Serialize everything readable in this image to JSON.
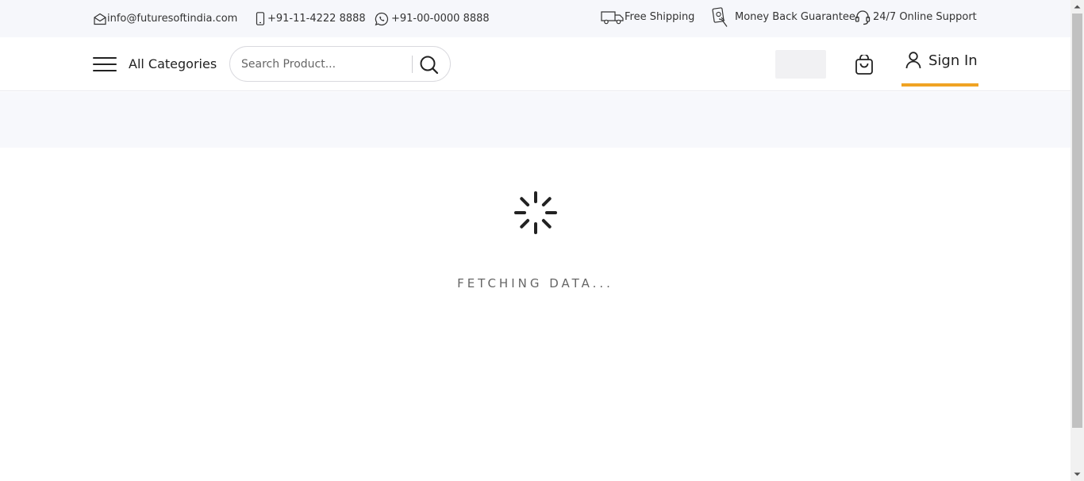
{
  "topbar": {
    "email": "info@futuresoftindia.com",
    "phone": "+91-11-4222 8888",
    "whatsapp": "+91-00-0000 8888",
    "shipping": "Free Shipping",
    "money_back": "Money Back Guarantee",
    "support": "24/7 Online Support"
  },
  "header": {
    "categories_label": "All Categories",
    "search_placeholder": "Search Product...",
    "signin_label": "Sign In",
    "accent_color": "#f0a323"
  },
  "loader": {
    "status_text": "FETCHING DATA..."
  },
  "icons": [
    "mail-icon",
    "phone-icon",
    "whatsapp-icon",
    "truck-icon",
    "money-back-icon",
    "headset-icon",
    "menu-icon",
    "search-icon",
    "cart-icon",
    "user-icon",
    "spinner-icon"
  ]
}
